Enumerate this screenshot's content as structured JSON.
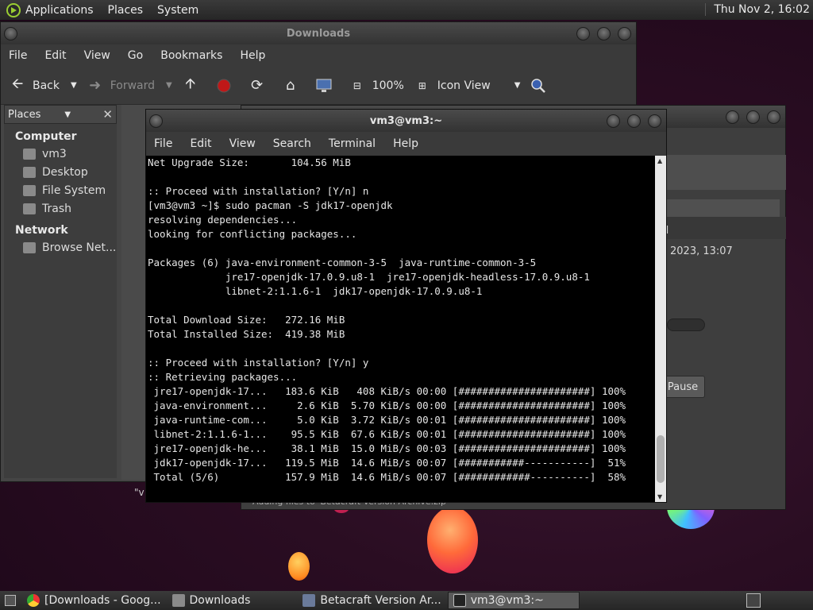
{
  "top_panel": {
    "menus": [
      "Applications",
      "Places",
      "System"
    ],
    "clock": "Thu Nov 2, 16:02"
  },
  "file_manager": {
    "title": "Downloads",
    "menu": [
      "File",
      "Edit",
      "View",
      "Go",
      "Bookmarks",
      "Help"
    ],
    "toolbar": {
      "back": "Back",
      "forward": "Forward",
      "zoom": "100%",
      "view_mode": "Icon View"
    },
    "sidebar": {
      "header": "Places",
      "sections": [
        {
          "title": "Computer",
          "items": [
            "vm3",
            "Desktop",
            "File System",
            "Trash"
          ]
        },
        {
          "title": "Network",
          "items": [
            "Browse Net..."
          ]
        }
      ]
    },
    "status_fragment": "\"v"
  },
  "betacraft": {
    "date_fragment": "2023, 13:07",
    "d_fragment": "d",
    "pause_label": "Pause",
    "footer": "Adding files to 'Betacraft Version Archive.zip'"
  },
  "terminal": {
    "title": "vm3@vm3:~",
    "menu": [
      "File",
      "Edit",
      "View",
      "Search",
      "Terminal",
      "Help"
    ],
    "lines": [
      "Net Upgrade Size:       104.56 MiB",
      "",
      ":: Proceed with installation? [Y/n] n",
      "[vm3@vm3 ~]$ sudo pacman -S jdk17-openjdk",
      "resolving dependencies...",
      "looking for conflicting packages...",
      "",
      "Packages (6) java-environment-common-3-5  java-runtime-common-3-5",
      "             jre17-openjdk-17.0.9.u8-1  jre17-openjdk-headless-17.0.9.u8-1",
      "             libnet-2:1.1.6-1  jdk17-openjdk-17.0.9.u8-1",
      "",
      "Total Download Size:   272.16 MiB",
      "Total Installed Size:  419.38 MiB",
      "",
      ":: Proceed with installation? [Y/n] y",
      ":: Retrieving packages...",
      " jre17-openjdk-17...   183.6 KiB   408 KiB/s 00:00 [######################] 100%",
      " java-environment...     2.6 KiB  5.70 KiB/s 00:00 [######################] 100%",
      " java-runtime-com...     5.0 KiB  3.72 KiB/s 00:01 [######################] 100%",
      " libnet-2:1.1.6-1...    95.5 KiB  67.6 KiB/s 00:01 [######################] 100%",
      " jre17-openjdk-he...    38.1 MiB  15.0 MiB/s 00:03 [######################] 100%",
      " jdk17-openjdk-17...   119.5 MiB  14.6 MiB/s 00:07 [###########-----------]  51%",
      " Total (5/6)           157.9 MiB  14.6 MiB/s 00:07 [############----------]  58%"
    ]
  },
  "taskbar": {
    "tasks": [
      "[Downloads - Goog...",
      "Downloads",
      "Betacraft Version Ar...",
      "vm3@vm3:~"
    ],
    "active_task": "vm3@vm3:~"
  }
}
